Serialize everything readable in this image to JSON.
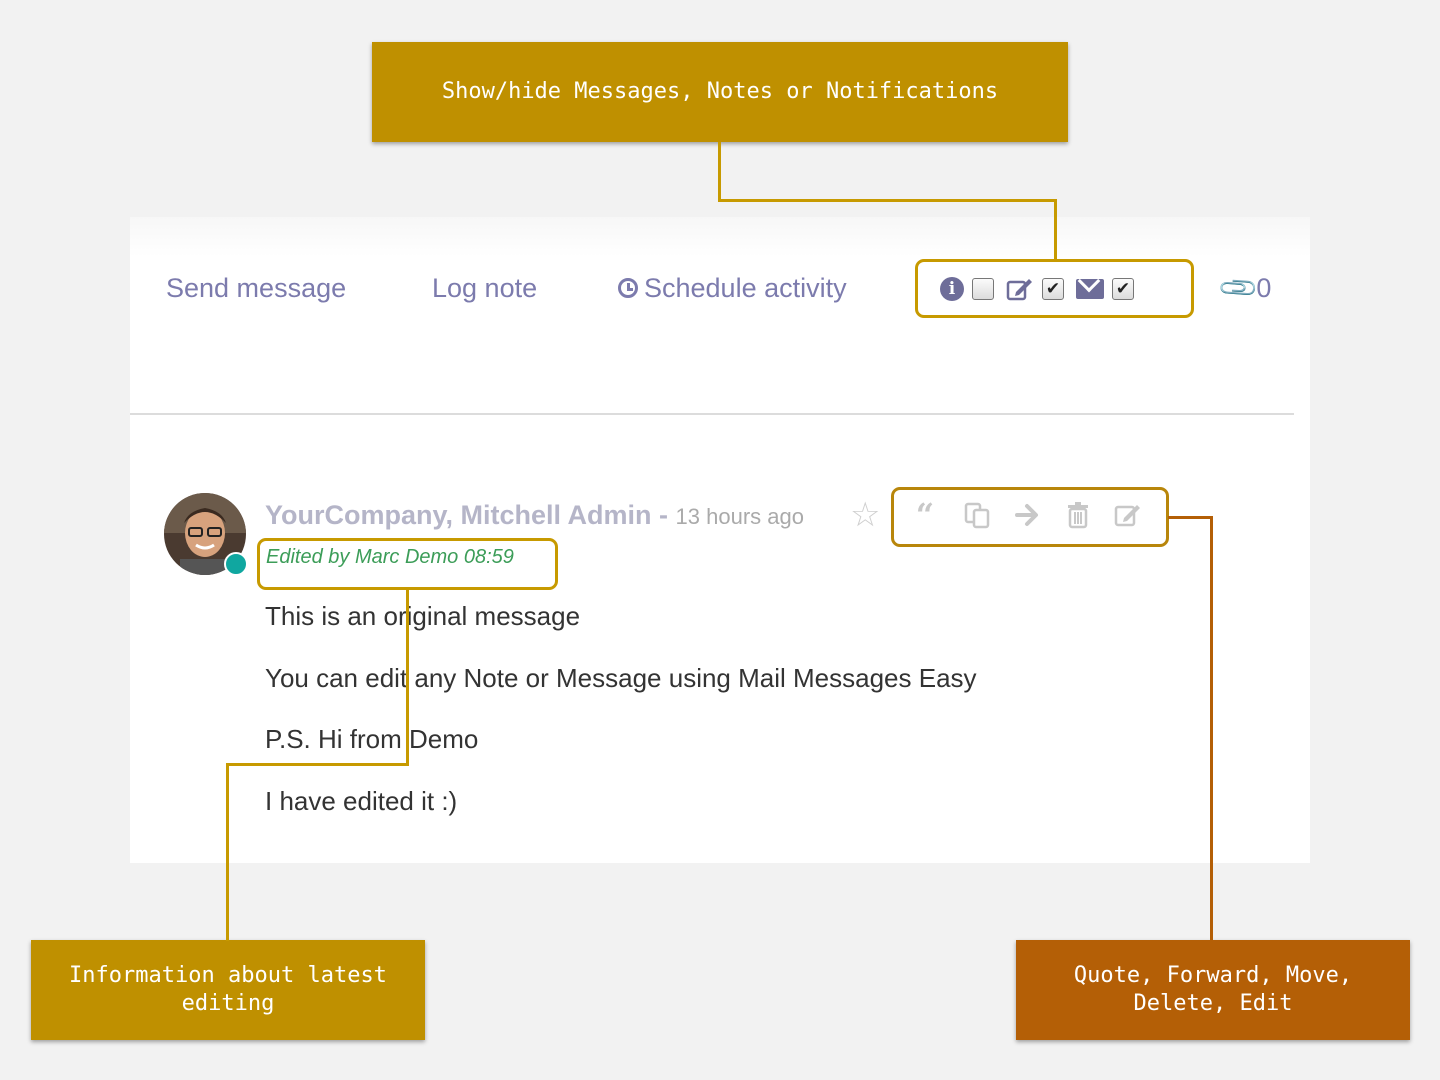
{
  "callouts": {
    "top": "Show/hide Messages, Notes or Notifications",
    "left": "Information about latest editing",
    "right": "Quote, Forward, Move, Delete, Edit"
  },
  "composer_tabs": {
    "send_message": "Send message",
    "log_note": "Log note",
    "schedule_activity": "Schedule activity"
  },
  "filters": [
    {
      "icon": "info-icon",
      "checked": false
    },
    {
      "icon": "note-edit-icon",
      "checked": true
    },
    {
      "icon": "envelope-icon",
      "checked": true
    }
  ],
  "attachments": {
    "count": "0"
  },
  "message": {
    "author": "YourCompany, Mitchell Admin",
    "separator": " - ",
    "time": "13 hours ago",
    "edited": "Edited by Marc Demo 08:59",
    "lines": [
      "This is an original message",
      "You can edit any Note or Message using Mail Messages Easy",
      "P.S. Hi from Demo",
      "I have edited it :)"
    ],
    "actions": [
      "quote",
      "forward",
      "move",
      "delete",
      "edit"
    ]
  },
  "colors": {
    "callout_gold": "#bf9000",
    "callout_orange": "#b45f06",
    "link_purple": "#7c7bad",
    "edited_green": "#3c9d58"
  }
}
